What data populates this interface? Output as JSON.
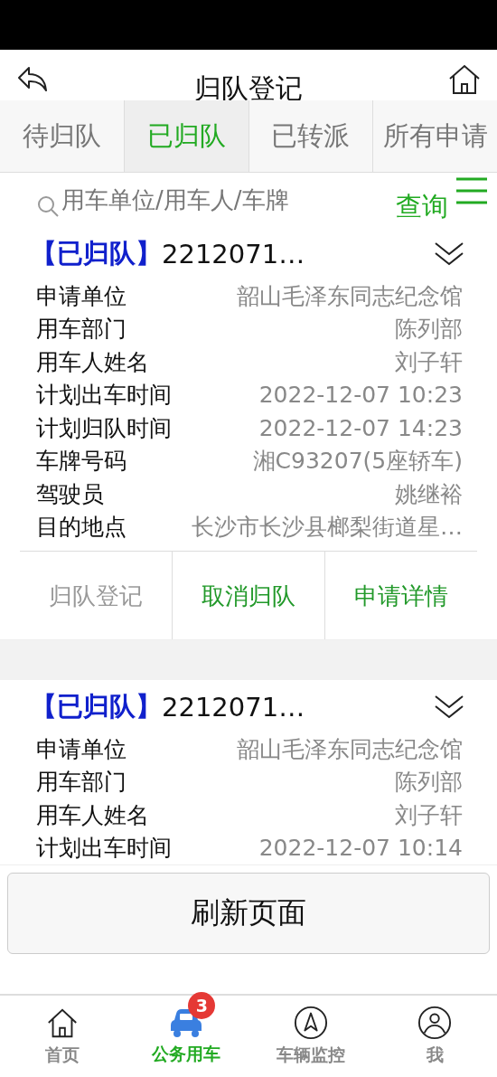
{
  "header": {
    "title": "归队登记"
  },
  "tabs": [
    {
      "label": "待归队",
      "selected": false
    },
    {
      "label": "已归队",
      "selected": true
    },
    {
      "label": "已转派",
      "selected": false
    },
    {
      "label": "所有申请",
      "selected": false
    }
  ],
  "search": {
    "placeholder": "用车单位/用车人/车牌",
    "button": "查询"
  },
  "cards": [
    {
      "status": "【已归队】",
      "number": "2212071…",
      "fields": [
        {
          "label": "申请单位",
          "value": "韶山毛泽东同志纪念馆"
        },
        {
          "label": "用车部门",
          "value": "陈列部"
        },
        {
          "label": "用车人姓名",
          "value": "刘子轩"
        },
        {
          "label": "计划出车时间",
          "value": "2022-12-07 10:23"
        },
        {
          "label": "计划归队时间",
          "value": "2022-12-07 14:23"
        },
        {
          "label": "车牌号码",
          "value": "湘C93207(5座轿车)"
        },
        {
          "label": "驾驶员",
          "value": "姚继裕"
        },
        {
          "label": "目的地点",
          "value": "长沙市长沙县榔梨街道星…"
        }
      ],
      "actions": [
        {
          "label": "归队登记",
          "disabled": true
        },
        {
          "label": "取消归队",
          "disabled": false
        },
        {
          "label": "申请详情",
          "disabled": false
        }
      ]
    },
    {
      "status": "【已归队】",
      "number": "2212071…",
      "fields": [
        {
          "label": "申请单位",
          "value": "韶山毛泽东同志纪念馆"
        },
        {
          "label": "用车部门",
          "value": "陈列部"
        },
        {
          "label": "用车人姓名",
          "value": "刘子轩"
        },
        {
          "label": "计划出车时间",
          "value": "2022-12-07 10:14"
        }
      ]
    }
  ],
  "refresh_button": "刷新页面",
  "nav": [
    {
      "kind": "home",
      "label": "首页",
      "selected": false
    },
    {
      "kind": "car",
      "label": "公务用车",
      "selected": true,
      "badge": "3"
    },
    {
      "kind": "compass",
      "label": "车辆监控",
      "selected": false
    },
    {
      "kind": "user",
      "label": "我",
      "selected": false
    }
  ]
}
